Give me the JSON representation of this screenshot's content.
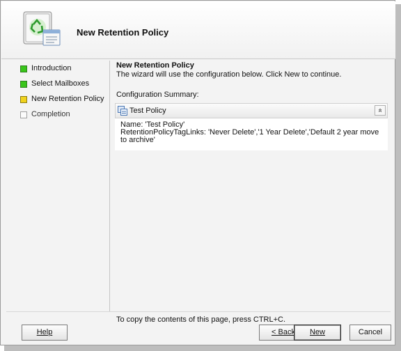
{
  "header": {
    "title": "New Retention Policy"
  },
  "nav": {
    "items": [
      {
        "label": "Introduction",
        "state": "done",
        "color": "#39c51a"
      },
      {
        "label": "Select Mailboxes",
        "state": "done",
        "color": "#39c51a"
      },
      {
        "label": "New Retention Policy",
        "state": "current",
        "color": "#f0d21c"
      },
      {
        "label": "Completion",
        "state": "pending",
        "color": "#fbfbfb"
      }
    ]
  },
  "content": {
    "title": "New Retention Policy",
    "description": "The wizard will use the configuration below.  Click New to continue.",
    "config_label": "Configuration Summary:",
    "policy": {
      "name": "Test Policy",
      "icon": "policy-icon",
      "collapse_glyph": "»",
      "details": [
        "Name: 'Test Policy'",
        "RetentionPolicyTagLinks: 'Never Delete','1 Year Delete','Default 2 year move to archive'"
      ]
    },
    "copy_hint": "To copy the contents of this page, press CTRL+C."
  },
  "buttons": {
    "help": "Help",
    "back": "< Back",
    "new": "New",
    "cancel": "Cancel"
  }
}
